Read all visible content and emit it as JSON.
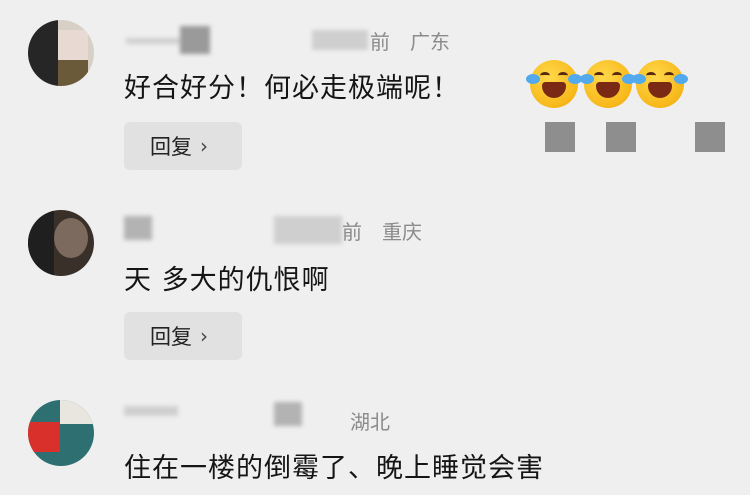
{
  "comments": [
    {
      "meta_time": "前",
      "meta_location": "广东",
      "text": "好合好分！何必走极端呢！",
      "emoji_name": "laughing-crying-emoji",
      "reply_label": "回复",
      "reply_chevron": "›"
    },
    {
      "meta_time": "前",
      "meta_location": "重庆",
      "text": "天 多大的仇恨啊",
      "reply_label": "回复",
      "reply_chevron": "›"
    },
    {
      "meta_location": "湖北",
      "text": "住在一楼的倒霉了、晚上睡觉会害"
    }
  ],
  "colors": {
    "background": "#efefef",
    "meta_text": "#8b8b8b",
    "reply_bg": "#e1e1e1"
  }
}
